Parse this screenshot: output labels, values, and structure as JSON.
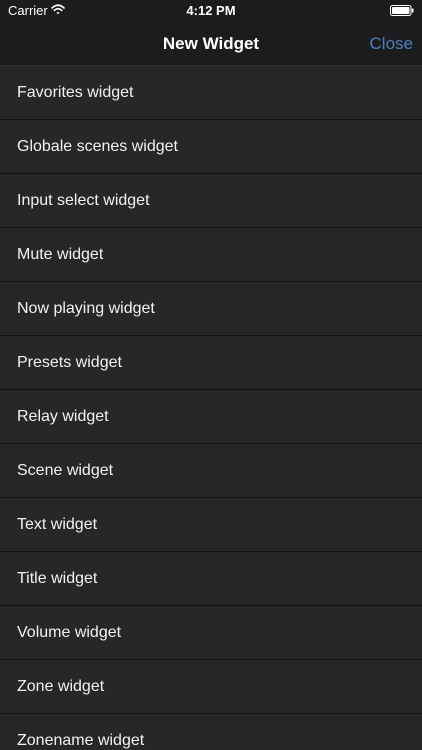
{
  "status_bar": {
    "carrier": "Carrier",
    "time": "4:12 PM",
    "icons": [
      "wifi-icon",
      "battery-icon"
    ]
  },
  "nav": {
    "title": "New Widget",
    "close_label": "Close",
    "accent_color": "#4a7fb8"
  },
  "list": {
    "items": [
      {
        "label": "Favorites widget"
      },
      {
        "label": "Globale scenes widget"
      },
      {
        "label": "Input select widget"
      },
      {
        "label": "Mute widget"
      },
      {
        "label": "Now playing widget"
      },
      {
        "label": "Presets widget"
      },
      {
        "label": "Relay widget"
      },
      {
        "label": "Scene widget"
      },
      {
        "label": "Text widget"
      },
      {
        "label": "Title widget"
      },
      {
        "label": "Volume widget"
      },
      {
        "label": "Zone widget"
      },
      {
        "label": "Zonename widget"
      }
    ]
  }
}
